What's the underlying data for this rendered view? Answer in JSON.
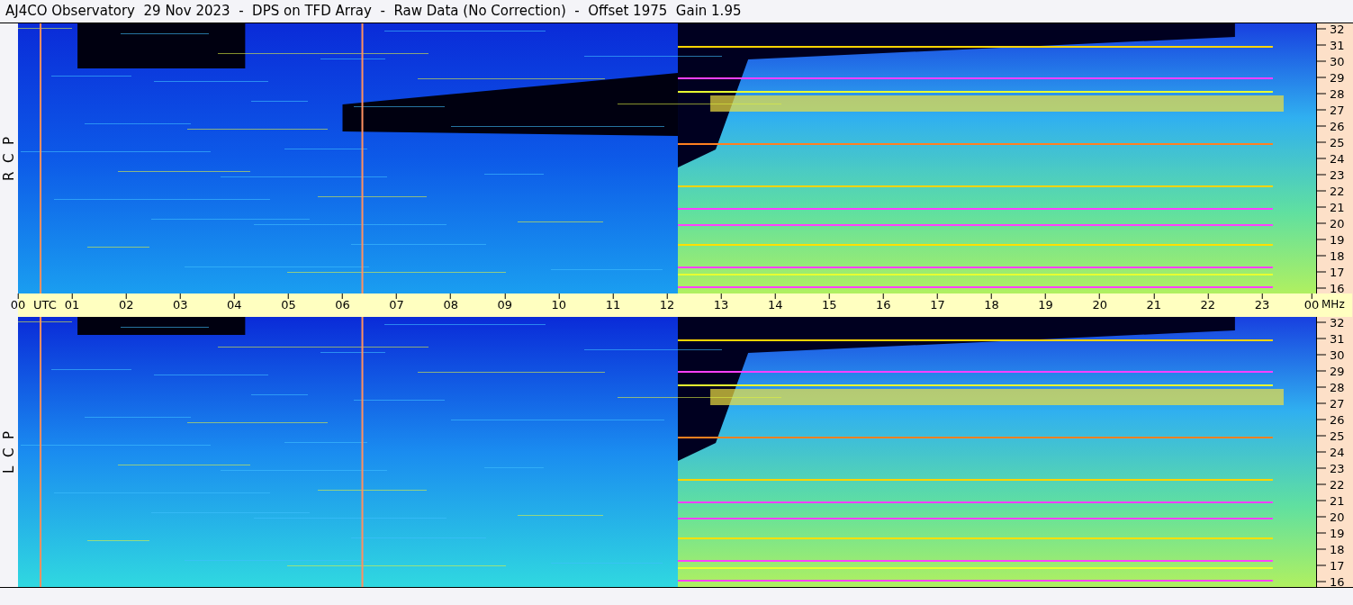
{
  "title": "AJ4CO Observatory  29 Nov 2023  -  DPS on TFD Array  -  Raw Data (No Correction)  -  Offset 1975  Gain 1.95",
  "panels": [
    {
      "label": "R  C  P",
      "freq_ticks": [
        "32",
        "31",
        "30",
        "29",
        "28",
        "27",
        "26",
        "25",
        "24",
        "23",
        "22",
        "21",
        "20",
        "19",
        "18",
        "17",
        "16"
      ]
    },
    {
      "label": "L  C  P",
      "freq_ticks": [
        "32",
        "31",
        "30",
        "29",
        "28",
        "27",
        "26",
        "25",
        "24",
        "23",
        "22",
        "21",
        "20",
        "19",
        "18",
        "17",
        "16"
      ]
    }
  ],
  "time_axis": {
    "ticks": [
      "00",
      "01",
      "02",
      "03",
      "04",
      "05",
      "06",
      "07",
      "08",
      "09",
      "10",
      "11",
      "12",
      "13",
      "14",
      "15",
      "16",
      "17",
      "18",
      "19",
      "20",
      "21",
      "22",
      "23",
      "00"
    ],
    "zone": "UTC",
    "unit": "MHz"
  }
}
